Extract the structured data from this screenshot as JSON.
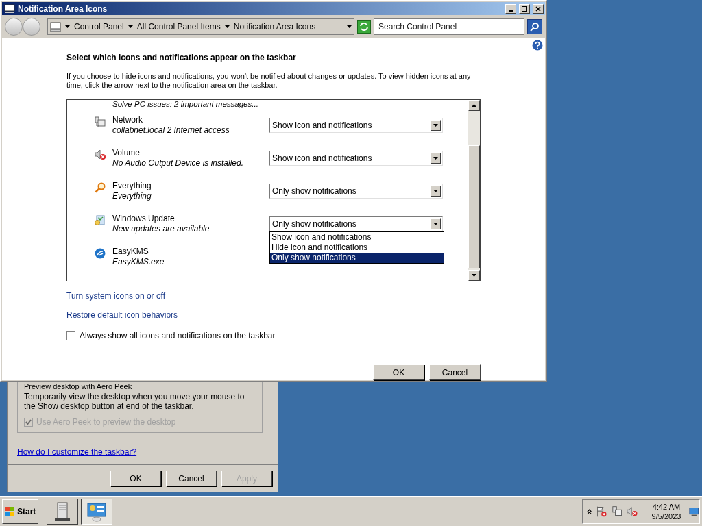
{
  "window": {
    "title": "Notification Area Icons"
  },
  "address_bar": {
    "crumbs": [
      "Control Panel",
      "All Control Panel Items",
      "Notification Area Icons"
    ]
  },
  "search": {
    "placeholder": "Search Control Panel"
  },
  "heading": "Select which icons and notifications appear on the taskbar",
  "description": "If you choose to hide icons and notifications, you won't be notified about changes or updates. To view hidden icons at any time, click the arrow next to the notification area on the taskbar.",
  "list": {
    "cut_item": "Solve PC issues: 2 important messages...",
    "items": [
      {
        "kind": "network",
        "name": "Network",
        "detail": "collabnet.local  2 Internet access",
        "behavior": "Show icon and notifications"
      },
      {
        "kind": "volume",
        "name": "Volume",
        "detail": "No Audio Output Device is installed.",
        "behavior": "Show icon and notifications"
      },
      {
        "kind": "search",
        "name": "Everything",
        "detail": "Everything",
        "behavior": "Only show notifications"
      },
      {
        "kind": "update",
        "name": "Windows Update",
        "detail": "New updates are available",
        "behavior": "Only show notifications",
        "open": true,
        "options": [
          {
            "label": "Show icon and notifications",
            "selected": false
          },
          {
            "label": "Hide icon and notifications",
            "selected": false
          },
          {
            "label": "Only show notifications",
            "selected": true
          }
        ]
      },
      {
        "kind": "kms",
        "name": "EasyKMS",
        "detail": "EasyKMS.exe"
      }
    ]
  },
  "links": [
    "Turn system icons on or off",
    "Restore default icon behaviors"
  ],
  "always_show": {
    "label": "Always show all icons and notifications on the taskbar",
    "checked": false
  },
  "buttons": [
    "OK",
    "Cancel"
  ],
  "background_window": {
    "group_title": "Preview desktop with Aero Peek",
    "group_text": "Temporarily view the desktop when you move your mouse to the Show desktop button at end of the taskbar.",
    "checkbox": {
      "label": "Use Aero Peek to preview the desktop",
      "checked": true,
      "disabled": true
    },
    "link": "How do I customize the taskbar?",
    "buttons": [
      {
        "label": "OK",
        "disabled": false
      },
      {
        "label": "Cancel",
        "disabled": false
      },
      {
        "label": "Apply",
        "disabled": true
      }
    ]
  },
  "taskbar": {
    "start": "Start",
    "buttons": [
      {
        "kind": "server",
        "selected": false
      },
      {
        "kind": "control_panel",
        "selected": true
      }
    ],
    "time": "4:42 AM",
    "date": "9/5/2023"
  }
}
